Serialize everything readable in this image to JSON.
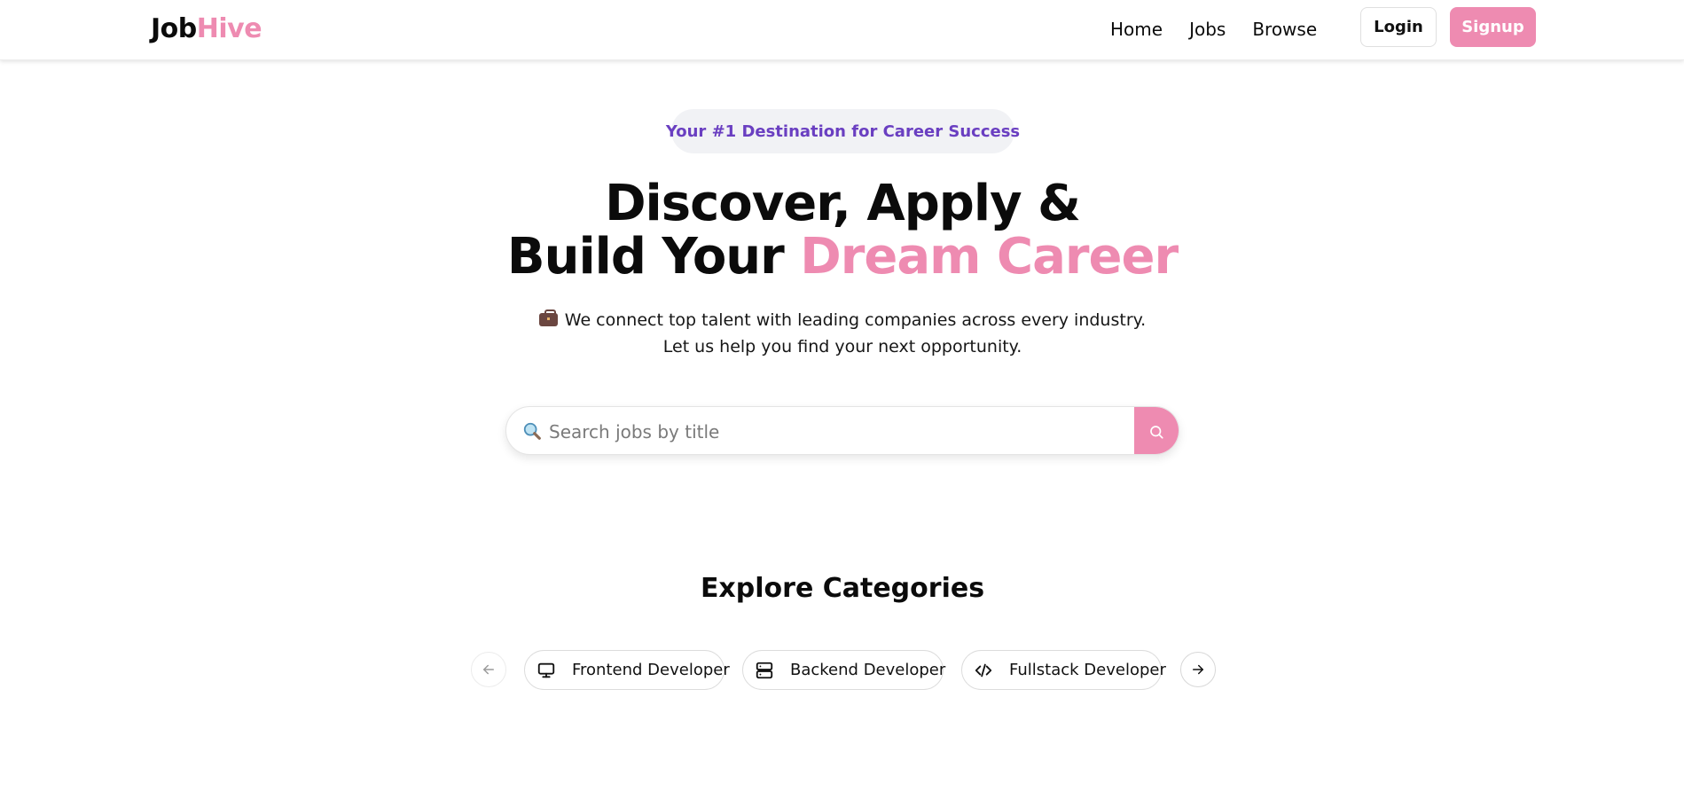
{
  "header": {
    "logo_part1": "Job",
    "logo_part2": "Hive",
    "nav": [
      {
        "label": "Home"
      },
      {
        "label": "Jobs"
      },
      {
        "label": "Browse"
      }
    ],
    "login_label": "Login",
    "signup_label": "Signup"
  },
  "hero": {
    "badge": "Your #1 Destination for Career Success",
    "title_line1": "Discover, Apply &",
    "title_line2_prefix": "Build Your ",
    "title_line2_accent": "Dream Career",
    "subtitle_line1": "We connect top talent with leading companies across every industry.",
    "subtitle_line2": "Let us help you find your next opportunity.",
    "subtitle_icon": "briefcase-icon"
  },
  "search": {
    "placeholder": "Search jobs by title",
    "value": "",
    "leading_icon": "magnifier-emoji-icon",
    "button_icon": "search-icon"
  },
  "categories": {
    "title": "Explore Categories",
    "prev_icon": "arrow-left-icon",
    "next_icon": "arrow-right-icon",
    "items": [
      {
        "label": "Frontend Developer",
        "icon": "monitor-icon"
      },
      {
        "label": "Backend Developer",
        "icon": "server-icon"
      },
      {
        "label": "Fullstack Developer",
        "icon": "code-icon"
      }
    ]
  },
  "colors": {
    "brand_pink": "#ee8bb1",
    "badge_text": "#6a3fc1",
    "badge_bg": "#f1f2f5"
  }
}
